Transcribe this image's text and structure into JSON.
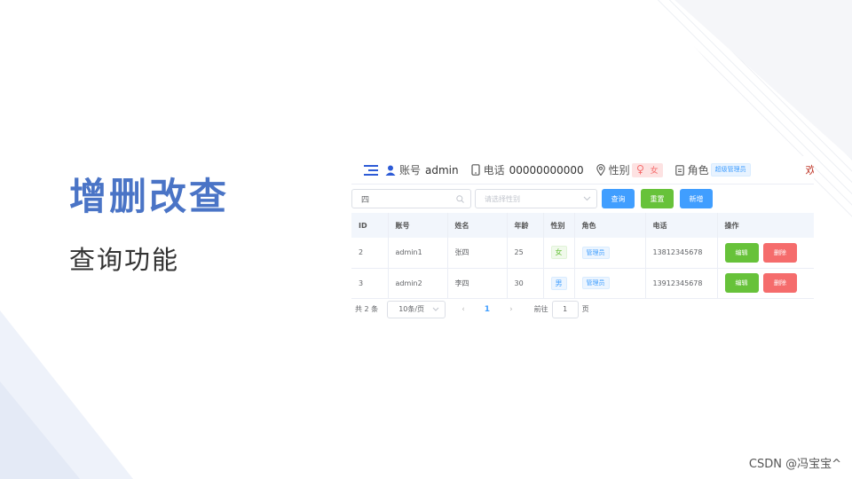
{
  "slide": {
    "title": "增删改查",
    "subtitle": "查询功能",
    "watermark": "CSDN @冯宝宝^"
  },
  "header": {
    "account_label": "账号",
    "account_value": "admin",
    "phone_label": "电话",
    "phone_value": "00000000000",
    "gender_label": "性别",
    "gender_value": "女",
    "role_label": "角色",
    "role_value": "超级管理员",
    "welcome_text": "欢"
  },
  "toolbar": {
    "search_value": "四",
    "select_placeholder": "请选择性别",
    "query_label": "查询",
    "reset_label": "重置",
    "add_label": "新增"
  },
  "table": {
    "columns": [
      "ID",
      "账号",
      "姓名",
      "年龄",
      "性别",
      "角色",
      "电话",
      "操作"
    ],
    "rows": [
      {
        "id": "2",
        "account": "admin1",
        "name": "张四",
        "age": "25",
        "sex": "女",
        "role": "管理员",
        "phone": "13812345678",
        "edit": "编辑",
        "delete": "删除"
      },
      {
        "id": "3",
        "account": "admin2",
        "name": "李四",
        "age": "30",
        "sex": "男",
        "role": "管理员",
        "phone": "13912345678",
        "edit": "编辑",
        "delete": "删除"
      }
    ]
  },
  "pagination": {
    "total_text": "共 2 条",
    "page_size": "10条/页",
    "current_page": "1",
    "goto_label": "前往",
    "goto_value": "1",
    "page_suffix": "页"
  },
  "colors": {
    "title": "#4a74c6",
    "primary": "#409eff",
    "success": "#67c23a",
    "danger": "#f56c6c"
  }
}
